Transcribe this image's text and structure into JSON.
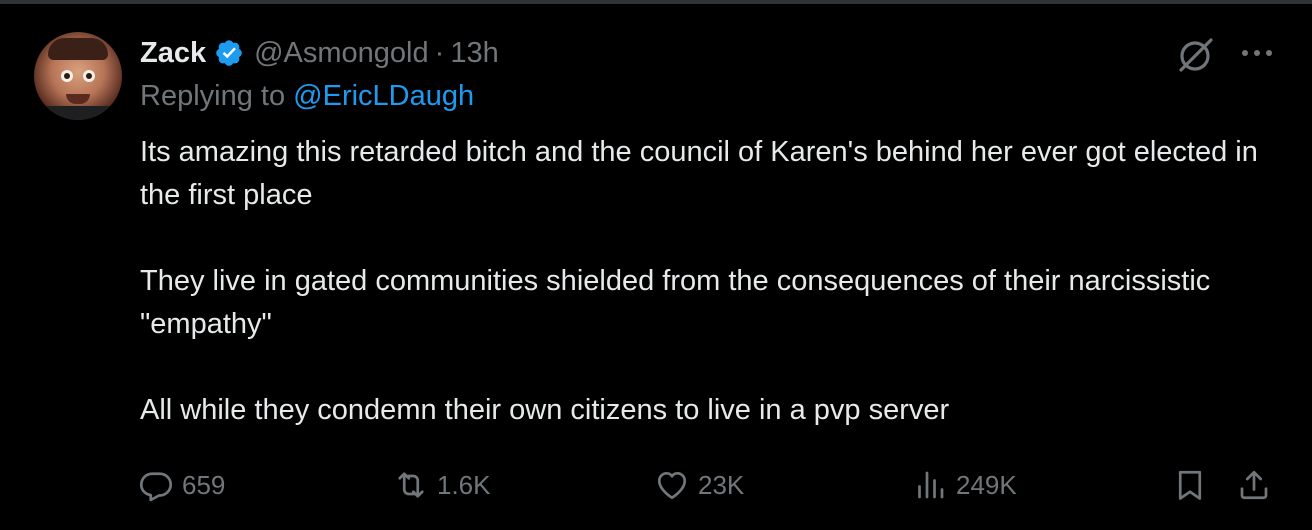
{
  "tweet": {
    "display_name": "Zack",
    "handle": "@Asmongold",
    "separator": "·",
    "time": "13h",
    "replying_prefix": "Replying to",
    "replying_to": "@EricLDaugh",
    "paragraphs": [
      "Its amazing this retarded bitch and the council of Karen's behind her ever got elected in the first place",
      "They live in gated communities shielded from the consequences of their narcissistic \"empathy\"",
      "All while they condemn their own citizens to live in a pvp server"
    ]
  },
  "actions": {
    "replies": "659",
    "reposts": "1.6K",
    "likes": "23K",
    "views": "249K"
  },
  "icons": {
    "verified": "verified-badge-icon",
    "grok": "grok-icon",
    "more": "more-icon",
    "reply": "reply-icon",
    "repost": "repost-icon",
    "like": "heart-icon",
    "views": "views-icon",
    "bookmark": "bookmark-icon",
    "share": "share-icon"
  },
  "colors": {
    "background": "#000000",
    "text": "#e7e9ea",
    "secondary": "#71767b",
    "accent": "#1d9bf0"
  }
}
